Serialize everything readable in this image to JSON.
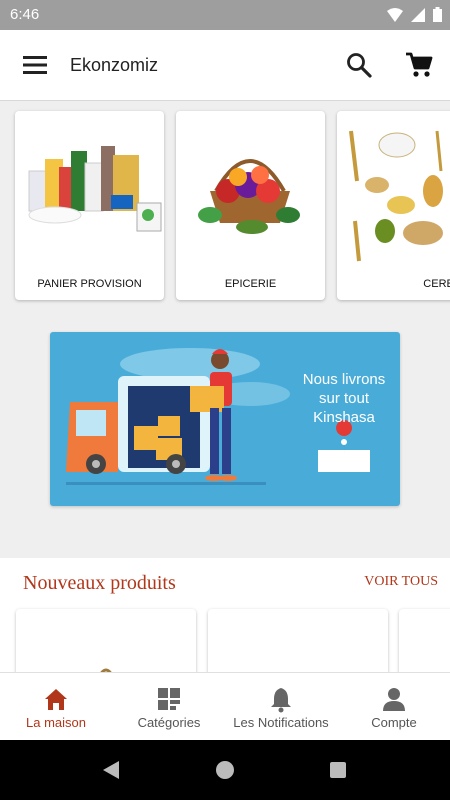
{
  "status_bar": {
    "time": "6:46"
  },
  "app_bar": {
    "title": "Ekonzomiz",
    "icons": [
      "menu-icon",
      "search-icon",
      "cart-icon"
    ]
  },
  "categories": [
    {
      "label": "PANIER PROVISION"
    },
    {
      "label": "EPICERIE"
    },
    {
      "label": "CEREALES"
    }
  ],
  "banner": {
    "line1": "Nous livrons",
    "line2": "sur tout",
    "line3": "Kinshasa"
  },
  "new_products": {
    "heading": "Nouveaux produits",
    "view_all": "VOIR TOUS"
  },
  "bottom_nav": [
    {
      "label": "La maison",
      "icon": "home-icon",
      "active": true
    },
    {
      "label": "Catégories",
      "icon": "categories-icon",
      "active": false
    },
    {
      "label": "Les Notifications",
      "icon": "bell-icon",
      "active": false
    },
    {
      "label": "Compte",
      "icon": "account-icon",
      "active": false
    }
  ],
  "colors": {
    "accent": "#b1371a",
    "banner_bg": "#49acd8",
    "status_bar": "#9e9e9e",
    "background": "#efefef"
  }
}
